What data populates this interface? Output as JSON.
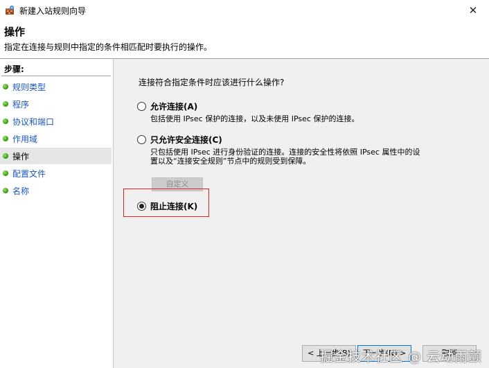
{
  "window": {
    "title": "新建入站规则向导",
    "close_glyph": "✕"
  },
  "header": {
    "title": "操作",
    "description": "指定在连接与规则中指定的条件相匹配时要执行的操作。"
  },
  "sidebar": {
    "title": "步骤:",
    "items": [
      {
        "label": "规则类型"
      },
      {
        "label": "程序"
      },
      {
        "label": "协议和端口"
      },
      {
        "label": "作用域"
      },
      {
        "label": "操作"
      },
      {
        "label": "配置文件"
      },
      {
        "label": "名称"
      }
    ]
  },
  "main": {
    "question": "连接符合指定条件时应该进行什么操作?",
    "options": [
      {
        "label": "允许连接(A)",
        "description": [
          "包括使用 IPsec 保护的连接，以及未使用 IPsec 保护的连接。"
        ],
        "checked": false
      },
      {
        "label": "只允许安全连接(C)",
        "description": [
          "只包括使用 IPsec 进行身份验证的连接。连接的安全性将依照 IPsec 属性中的设",
          "置以及“连接安全规则”节点中的规则受到保障。"
        ],
        "checked": false
      },
      {
        "label": "阻止连接(K)",
        "description": [],
        "checked": true
      }
    ],
    "customize_label": "自定义"
  },
  "footer": {
    "back_label": "< 上一步(B)",
    "next_label": "下一步(N) >",
    "cancel_label": "取消"
  },
  "watermark": "掘金技术社区 @ 云动雨颤",
  "colors": {
    "link": "#1a56c4",
    "highlight": "#e02020",
    "active_step_bg": "#e6e6e6"
  }
}
